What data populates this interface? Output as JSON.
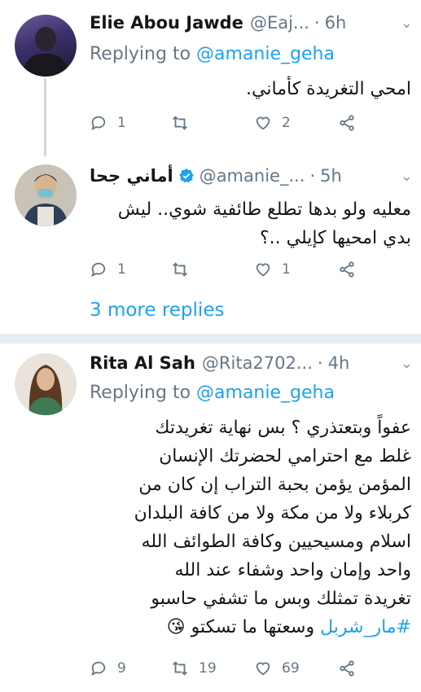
{
  "tweets": [
    {
      "name": "Elie Abou Jawde",
      "handle": "@Eaj...",
      "time": "6h",
      "replying_prefix": "Replying to",
      "replying_to": "@amanie_geha",
      "text": "امحي التغريدة كأماني.",
      "replies": "1",
      "retweets": "",
      "likes": "2"
    },
    {
      "name": "أماني جحا",
      "handle": "@amanie_...",
      "time": "5h",
      "verified": true,
      "text_lines": [
        "معليه ولو بدها تطلع طائفية شوي.. ليش",
        "بدي امحيها كإيلي ..؟"
      ],
      "replies": "1",
      "retweets": "",
      "likes": "1"
    },
    {
      "name": "Rita Al Sah",
      "handle": "@Rita2702...",
      "time": "4h",
      "replying_prefix": "Replying to",
      "replying_to": "@amanie_geha",
      "text_lines": [
        "عفواً وبتعتذري ؟ بس نهاية تغريدتك",
        "غلط مع احترامي لحضرتك الإنسان",
        "المؤمن يؤمن بحبة التراب إن كان من",
        "كربلاء ولا من مكة ولا من كافة البلدان",
        "اسلام ومسيحيين وكافة الطوائف الله",
        "واحد وإمان واحد وشفاء عند الله",
        "تغريدة تمثلك وبس ما تشفي حاسبو"
      ],
      "hashtag": "#مار_شربل",
      "last_line_rest": "وسعتها ما تسكتو",
      "emoji": "😘",
      "replies": "9",
      "retweets": "19",
      "likes": "69"
    }
  ],
  "more_replies": "3 more replies",
  "colors": {
    "link": "#1da1f2",
    "muted": "#657786",
    "divider": "#e6ecf0"
  }
}
